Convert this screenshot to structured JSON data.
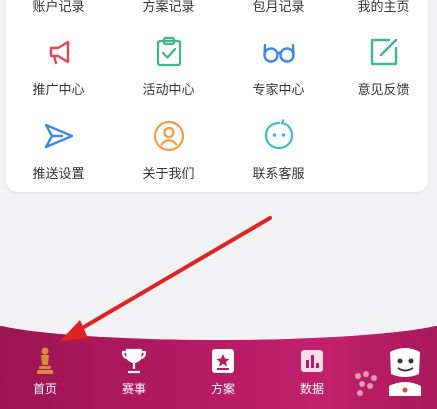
{
  "top_row": [
    "账户记录",
    "方案记录",
    "包月记录",
    "我的主页"
  ],
  "grid": [
    {
      "label": "推广中心",
      "icon": "megaphone-icon",
      "color": "#e5454f"
    },
    {
      "label": "活动中心",
      "icon": "clipboard-check-icon",
      "color": "#3fb58c"
    },
    {
      "label": "专家中心",
      "icon": "glasses-icon",
      "color": "#3c8be0"
    },
    {
      "label": "意见反馈",
      "icon": "edit-icon",
      "color": "#3fb58c"
    },
    {
      "label": "推送设置",
      "icon": "send-icon",
      "color": "#3c8be0"
    },
    {
      "label": "关于我们",
      "icon": "user-circle-icon",
      "color": "#f39a45"
    },
    {
      "label": "联系客服",
      "icon": "chat-bubble-icon",
      "color": "#3fb8d8"
    }
  ],
  "tabbar": {
    "items": [
      {
        "label": "首页",
        "icon": "trophy-figure-icon"
      },
      {
        "label": "赛事",
        "icon": "cup-icon"
      },
      {
        "label": "方案",
        "icon": "document-star-icon"
      },
      {
        "label": "数据",
        "icon": "chart-icon"
      }
    ],
    "background_color": "#b51a63"
  }
}
